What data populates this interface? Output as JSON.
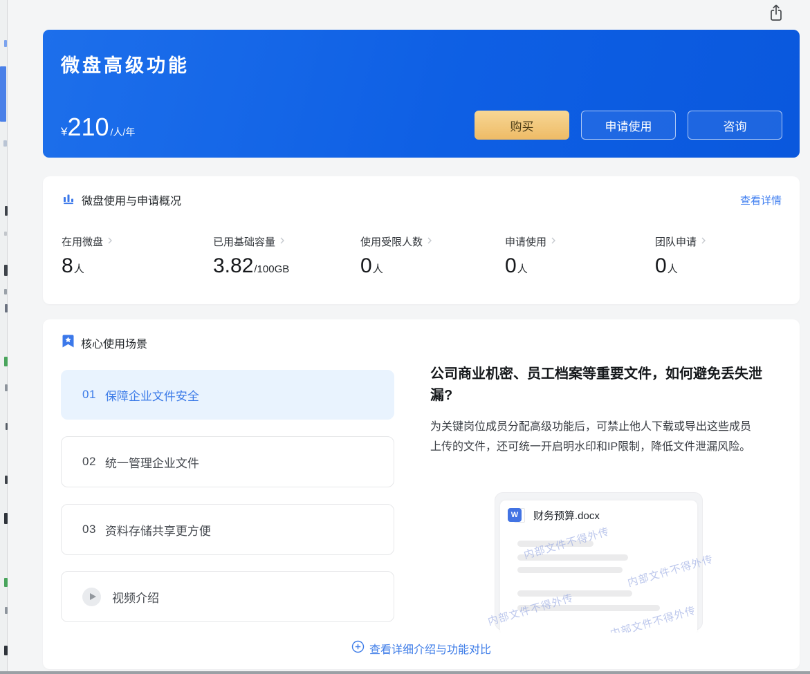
{
  "colors": {
    "accent_blue": "#3d7ce8",
    "link_blue": "#407ff0",
    "banner_blue_start": "#1d6feb",
    "banner_blue_end": "#0a58dd",
    "buy_gold_start": "#f7d795",
    "buy_gold_end": "#eebb66",
    "active_item_bg": "#e9f3fe",
    "watermark_blue": "#8fa2e0"
  },
  "topbar": {
    "share_icon": "share-export-icon"
  },
  "banner": {
    "title": "微盘高级功能",
    "currency": "¥",
    "price": "210",
    "unit": "/人/年",
    "buy_label": "购买",
    "apply_label": "申请使用",
    "consult_label": "咨询"
  },
  "usage_card": {
    "icon": "bar-chart-icon",
    "title": "微盘使用与申请概况",
    "detail_link": "查看详情",
    "stats": [
      {
        "label": "在用微盘",
        "value": "8",
        "suffix": "人"
      },
      {
        "label": "已用基础容量",
        "value": "3.82",
        "suffix": "/100GB"
      },
      {
        "label": "使用受限人数",
        "value": "0",
        "suffix": "人"
      },
      {
        "label": "申请使用",
        "value": "0",
        "suffix": "人"
      },
      {
        "label": "团队申请",
        "value": "0",
        "suffix": "人"
      }
    ]
  },
  "scenarios": {
    "icon": "bookmark-star-icon",
    "title": "核心使用场景",
    "items": [
      {
        "num": "01",
        "label": "保障企业文件安全"
      },
      {
        "num": "02",
        "label": "统一管理企业文件"
      },
      {
        "num": "03",
        "label": "资料存储共享更方便"
      }
    ],
    "video_label": "视频介绍",
    "detail": {
      "heading": "公司商业机密、员工档案等重要文件，如何避免丢失泄漏?",
      "body": "为关键岗位成员分配高级功能后，可禁止他人下载或导出这些成员上传的文件，还可统一开启明水印和IP限制，降低文件泄漏风险。",
      "doc_filename": "财务预算.docx",
      "doc_icon": "word-document-icon",
      "watermark": "内部文件不得外传"
    },
    "compare_link": "查看详细介绍与功能对比"
  }
}
